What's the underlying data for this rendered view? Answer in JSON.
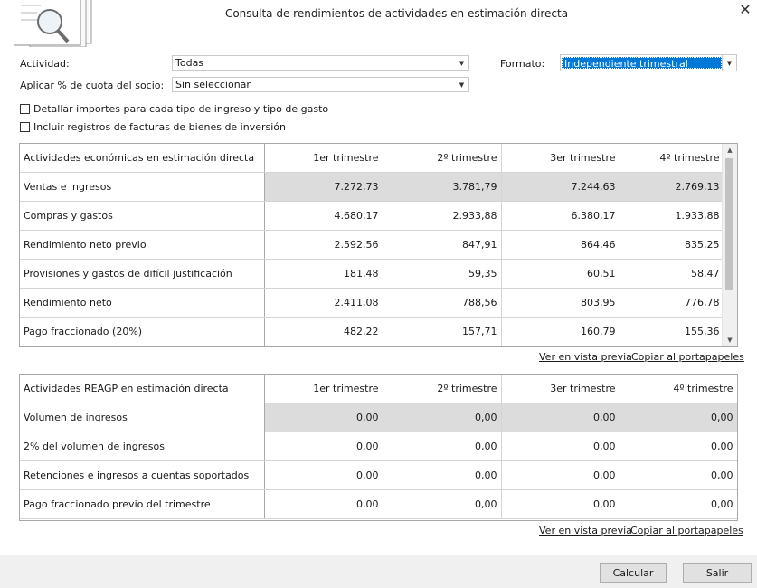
{
  "window": {
    "title": "Consulta de rendimientos de actividades en estimación directa",
    "close_label": "✕"
  },
  "form": {
    "actividad_label": "Actividad:",
    "actividad_value": "Todas",
    "formato_label": "Formato:",
    "formato_value": "Independiente trimestral",
    "cuota_label": "Aplicar % de cuota del socio:",
    "cuota_value": "Sin seleccionar",
    "chk_detallar": "Detallar importes para cada tipo de ingreso y tipo de gasto",
    "chk_incluir": "Incluir registros de facturas de bienes de inversión"
  },
  "table1": {
    "headers": [
      "Actividades económicas en estimación directa",
      "1er trimestre",
      "2º trimestre",
      "3er trimestre",
      "4º trimestre"
    ],
    "rows": [
      [
        "Ventas e ingresos",
        "7.272,73",
        "3.781,79",
        "7.244,63",
        "2.769,13"
      ],
      [
        "Compras y gastos",
        "4.680,17",
        "2.933,88",
        "6.380,17",
        "1.933,88"
      ],
      [
        "Rendimiento neto previo",
        "2.592,56",
        "847,91",
        "864,46",
        "835,25"
      ],
      [
        "Provisiones y gastos de difícil justificación",
        "181,48",
        "59,35",
        "60,51",
        "58,47"
      ],
      [
        "Rendimiento neto",
        "2.411,08",
        "788,56",
        "803,95",
        "776,78"
      ],
      [
        "Pago fraccionado (20%)",
        "482,22",
        "157,71",
        "160,79",
        "155,36"
      ]
    ],
    "link_preview": "Ver en vista previa",
    "link_copy": "Copiar al portapapeles"
  },
  "table2": {
    "headers": [
      "Actividades REAGP en estimación directa",
      "1er trimestre",
      "2º trimestre",
      "3er trimestre",
      "4º trimestre"
    ],
    "rows": [
      [
        "Volumen de ingresos",
        "0,00",
        "0,00",
        "0,00",
        "0,00"
      ],
      [
        "2% del volumen de ingresos",
        "0,00",
        "0,00",
        "0,00",
        "0,00"
      ],
      [
        "Retenciones e ingresos a cuentas soportados",
        "0,00",
        "0,00",
        "0,00",
        "0,00"
      ],
      [
        "Pago fraccionado previo del trimestre",
        "0,00",
        "0,00",
        "0,00",
        "0,00"
      ]
    ],
    "link_preview": "Ver en vista previa",
    "link_copy": "Copiar al portapapeles"
  },
  "buttons": {
    "calcular": "Calcular",
    "salir": "Salir"
  },
  "icons": {
    "header": "document-search-icon",
    "dropdown": "chevron-down-icon"
  }
}
